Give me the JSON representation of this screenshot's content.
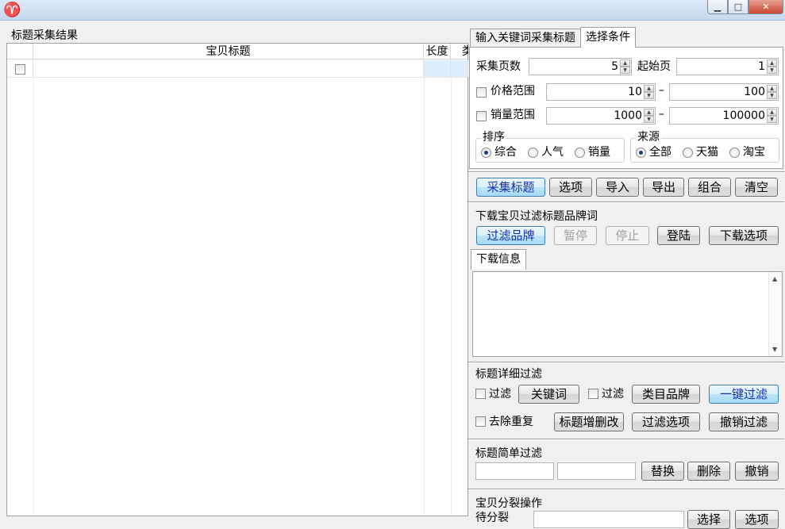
{
  "window": {
    "minimize": "▁",
    "maximize": "□",
    "close": "✕",
    "icon": "ram-logo-icon"
  },
  "results": {
    "group_title": "标题采集结果",
    "columns": [
      "宝贝标题",
      "长度",
      "类"
    ]
  },
  "tabs": [
    "输入关键词采集标题",
    "选择条件"
  ],
  "conditions": {
    "pages_label": "采集页数",
    "pages_value": "5",
    "start_page_label": "起始页",
    "start_page_value": "1",
    "price_label": "价格范围",
    "price_min": "10",
    "price_max": "100",
    "sales_label": "销量范围",
    "sales_min": "1000",
    "sales_max": "100000",
    "range_dash": "–",
    "sort_title": "排序",
    "sort_options": [
      "综合",
      "人气",
      "销量"
    ],
    "source_title": "来源",
    "source_options": [
      "全部",
      "天猫",
      "淘宝"
    ]
  },
  "actions": [
    "采集标题",
    "选项",
    "导入",
    "导出",
    "组合",
    "清空"
  ],
  "download": {
    "section_title": "下载宝贝过滤标题品牌词",
    "buttons": [
      "过滤品牌",
      "暂停",
      "停止",
      "登陆",
      "下载选项"
    ],
    "info_tab": "下载信息"
  },
  "detail_filter": {
    "section_title": "标题详细过滤",
    "filter_label_1": "过滤",
    "keyword_button": "关键词",
    "filter_label_2": "过滤",
    "category_button": "类目品牌",
    "one_click_button": "一键过滤",
    "dedupe_label": "去除重复",
    "edit_button": "标题增删改",
    "options_button": "过滤选项",
    "undo_button": "撤销过滤"
  },
  "simple_filter": {
    "section_title": "标题简单过滤",
    "replace_button": "替换",
    "delete_button": "删除",
    "undo_button": "撤销"
  },
  "split": {
    "section_title": "宝贝分裂操作",
    "row_label": "待分裂",
    "select_button": "选择",
    "other_button": "选项"
  }
}
